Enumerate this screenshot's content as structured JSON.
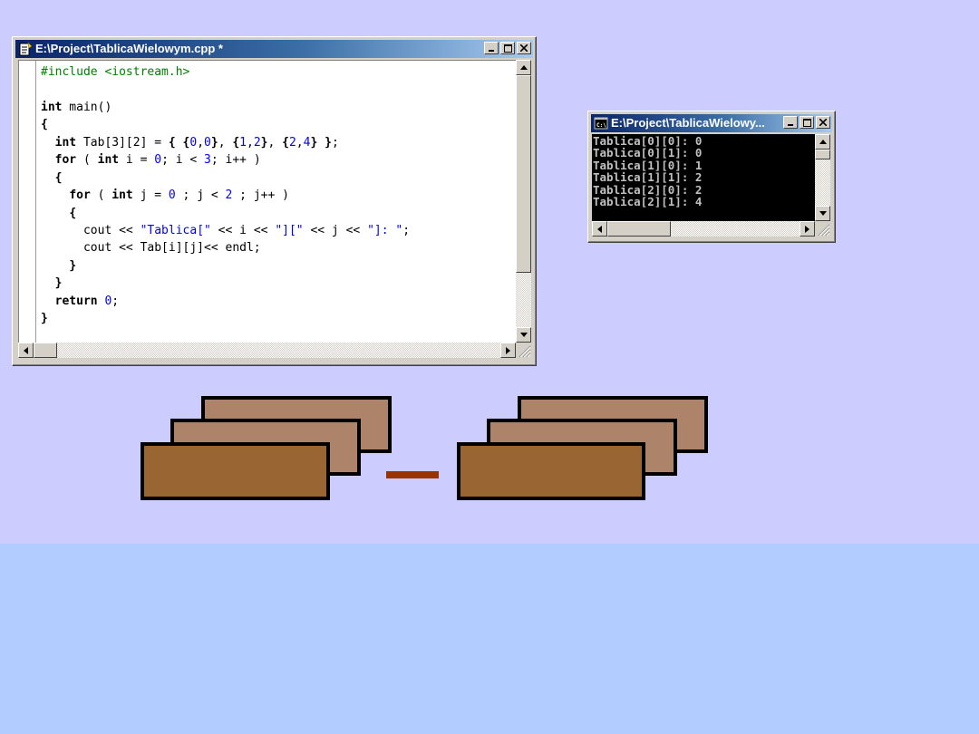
{
  "editor_window": {
    "title": "E:\\Project\\TablicaWielowym.cpp *",
    "icon": "document-icon",
    "buttons": [
      "minimize",
      "maximize",
      "close"
    ],
    "code_lines": [
      [
        {
          "t": "#include <iostream.h>",
          "c": "pp"
        }
      ],
      [],
      [
        {
          "t": "int",
          "c": "kw"
        },
        {
          "t": " main()"
        }
      ],
      [
        {
          "t": "{",
          "c": "kw"
        }
      ],
      [
        {
          "t": "  "
        },
        {
          "t": "int",
          "c": "kw"
        },
        {
          "t": " Tab[3][2] = "
        },
        {
          "t": "{",
          "c": "kw"
        },
        {
          "t": " "
        },
        {
          "t": "{",
          "c": "kw"
        },
        {
          "t": "0",
          "c": "num"
        },
        {
          "t": ","
        },
        {
          "t": "0",
          "c": "num"
        },
        {
          "t": "}",
          "c": "kw"
        },
        {
          "t": ", "
        },
        {
          "t": "{",
          "c": "kw"
        },
        {
          "t": "1",
          "c": "num"
        },
        {
          "t": ","
        },
        {
          "t": "2",
          "c": "num"
        },
        {
          "t": "}",
          "c": "kw"
        },
        {
          "t": ", "
        },
        {
          "t": "{",
          "c": "kw"
        },
        {
          "t": "2",
          "c": "num"
        },
        {
          "t": ","
        },
        {
          "t": "4",
          "c": "num"
        },
        {
          "t": "}",
          "c": "kw"
        },
        {
          "t": " "
        },
        {
          "t": "}",
          "c": "kw"
        },
        {
          "t": ";"
        }
      ],
      [
        {
          "t": "  "
        },
        {
          "t": "for",
          "c": "kw"
        },
        {
          "t": " ( "
        },
        {
          "t": "int",
          "c": "kw"
        },
        {
          "t": " i = "
        },
        {
          "t": "0",
          "c": "num"
        },
        {
          "t": "; i < "
        },
        {
          "t": "3",
          "c": "num"
        },
        {
          "t": "; i++ )"
        }
      ],
      [
        {
          "t": "  "
        },
        {
          "t": "{",
          "c": "kw"
        }
      ],
      [
        {
          "t": "    "
        },
        {
          "t": "for",
          "c": "kw"
        },
        {
          "t": " ( "
        },
        {
          "t": "int",
          "c": "kw"
        },
        {
          "t": " j = "
        },
        {
          "t": "0",
          "c": "num"
        },
        {
          "t": " ; j < "
        },
        {
          "t": "2",
          "c": "num"
        },
        {
          "t": " ; j++ )"
        }
      ],
      [
        {
          "t": "    "
        },
        {
          "t": "{",
          "c": "kw"
        }
      ],
      [
        {
          "t": "      cout << "
        },
        {
          "t": "\"Tablica[\"",
          "c": "str"
        },
        {
          "t": " << i << "
        },
        {
          "t": "\"][\"",
          "c": "str"
        },
        {
          "t": " << j << "
        },
        {
          "t": "\"]: \"",
          "c": "str"
        },
        {
          "t": ";"
        }
      ],
      [
        {
          "t": "      cout << Tab[i][j]<< endl;"
        }
      ],
      [
        {
          "t": "    "
        },
        {
          "t": "}",
          "c": "kw"
        }
      ],
      [
        {
          "t": "  "
        },
        {
          "t": "}",
          "c": "kw"
        }
      ],
      [
        {
          "t": "  "
        },
        {
          "t": "return",
          "c": "kw"
        },
        {
          "t": " "
        },
        {
          "t": "0",
          "c": "num"
        },
        {
          "t": ";"
        }
      ],
      [
        {
          "t": "}",
          "c": "kw"
        }
      ]
    ]
  },
  "console_window": {
    "title": "E:\\Project\\TablicaWielowy...",
    "icon": "console-icon",
    "buttons": [
      "minimize",
      "maximize",
      "close"
    ],
    "output_lines": [
      "Tablica[0][0]: 0",
      "Tablica[0][1]: 0",
      "Tablica[1][0]: 1",
      "Tablica[1][1]: 2",
      "Tablica[2][0]: 2",
      "Tablica[2][1]: 4"
    ]
  },
  "colors": {
    "background_top": "#ccccff",
    "background_bottom": "#b3ccff",
    "block_front": "#996633",
    "block_back": "#ad8469",
    "dash": "#993300"
  }
}
